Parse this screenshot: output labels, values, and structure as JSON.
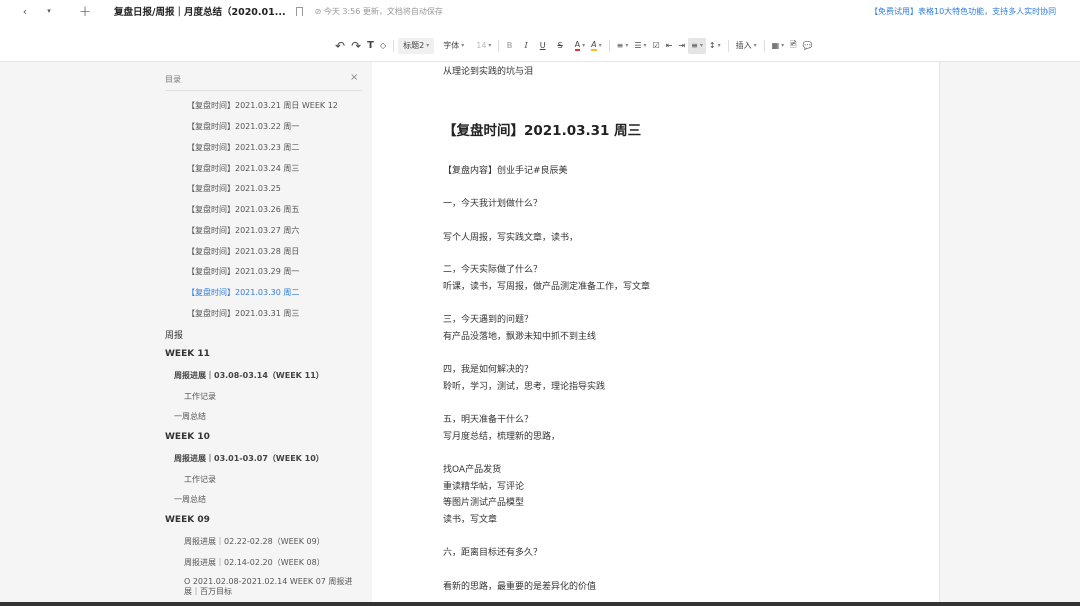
{
  "topbar": {
    "back": "‹",
    "dropdown": "▾",
    "new_tab": "+",
    "doc_title": "复盘日报/周报｜月度总结（2020.01...",
    "save_status": "⊘ 今天 3:56 更新，文档将自动保存",
    "promo": "【免费试用】表格10大特色功能，支持多人实时协同"
  },
  "toolbar": {
    "undo": "↶",
    "redo": "↷",
    "format_painter": "T",
    "clear_format": "◇",
    "heading": "标题2",
    "font": "字体",
    "font_size": "14",
    "bold": "B",
    "italic": "I",
    "underline": "U",
    "strike": "S",
    "font_color": "A",
    "highlight": "A",
    "ordered_list": "≡",
    "bullet_list": "☰",
    "todo": "☑",
    "outdent": "⇤",
    "indent": "⇥",
    "align": "≡",
    "line_height": "↕",
    "insert": "插入",
    "table": "▦",
    "image": "🖻",
    "comment": "💬",
    "caret": "▾"
  },
  "toc": {
    "title": "目录",
    "close": "×",
    "items": [
      {
        "text": "【复盘时间】2021.03.21 周日 WEEK 12"
      },
      {
        "text": "【复盘时间】2021.03.22 周一"
      },
      {
        "text": "【复盘时间】2021.03.23 周二"
      },
      {
        "text": "【复盘时间】2021.03.24 周三"
      },
      {
        "text": "【复盘时间】2021.03.25"
      },
      {
        "text": "【复盘时间】2021.03.26 周五"
      },
      {
        "text": "【复盘时间】2021.03.27 周六"
      },
      {
        "text": "【复盘时间】2021.03.28 周日"
      },
      {
        "text": "【复盘时间】2021.03.29 周一"
      },
      {
        "text": "【复盘时间】2021.03.30 周二"
      },
      {
        "text": "【复盘时间】2021.03.31 周三"
      },
      {
        "text": "周报"
      },
      {
        "text": "WEEK 11"
      },
      {
        "text": "周报进展｜03.08-03.14（WEEK 11）"
      },
      {
        "text": "工作记录"
      },
      {
        "text": "一周总结"
      },
      {
        "text": "WEEK 10"
      },
      {
        "text": "周报进展｜03.01-03.07（WEEK 10）"
      },
      {
        "text": "工作记录"
      },
      {
        "text": "一周总结"
      },
      {
        "text": "WEEK 09"
      },
      {
        "text": "周报进展｜02.22-02.28（WEEK 09）"
      },
      {
        "text": "周报进展｜02.14-02.20（WEEK 08）"
      },
      {
        "text": "O 2021.02.08-2021.02.14 WEEK 07 周报进展｜百万目标"
      }
    ]
  },
  "doc": {
    "lines": [
      "从理论到实践的坑与泪",
      "【复盘时间】2021.03.31 周三",
      "【复盘内容】创业手记#良辰美",
      "一，今天我计划做什么？",
      "写个人周报，写实践文章，读书，",
      "二，今天实际做了什么？",
      "听课，读书，写周报，做产品测定准备工作，写文章",
      "三，今天遇到的问题？",
      "有产品没落地，飘渺未知中抓不到主线",
      "四，我是如何解决的？",
      "聆听，学习，测试，思考，理论指导实践",
      "五，明天准备干什么？",
      "写月度总结，梳理新的思路，",
      "找OA产品发货",
      "重读精华帖，写评论",
      "等图片测试产品模型",
      "读书，写文章",
      "六，距离目标还有多久？",
      "看新的思路，最重要的是差异化的价值"
    ]
  }
}
